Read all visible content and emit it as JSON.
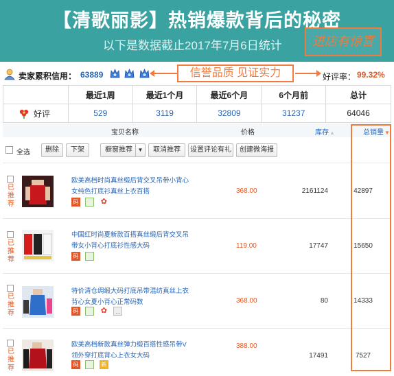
{
  "banner": {
    "title": "【清歌丽影】热销爆款背后的秘密",
    "subtitle": "以下是数据截止2017年7月6日统计",
    "stamp": "进店有惊喜"
  },
  "credit": {
    "label": "卖家累积信用：",
    "value": "63889",
    "callout": "信誉品质 见证实力",
    "rate_label": "好评率：",
    "rate_value": "99.32%"
  },
  "rating": {
    "headers": [
      "最近1周",
      "最近1个月",
      "最近6个月",
      "6个月前",
      "总计"
    ],
    "row_label": "好评",
    "values": [
      "529",
      "3119",
      "32809",
      "31237",
      "64046"
    ]
  },
  "product_header": {
    "name": "宝贝名称",
    "price": "价格",
    "stock": "库存",
    "sales": "总销量"
  },
  "toolbar": {
    "select_all": "全选",
    "delete": "删除",
    "offshelf": "下架",
    "showcase": "橱窗推荐",
    "cancel_recommend": "取消推荐",
    "set_review_gift": "设置评论有礼",
    "create_poster": "创建微海报"
  },
  "products": [
    {
      "status": "已推荐",
      "title": "欧美高档时尚真丝缎后背交叉吊带小背心女纯色打底衫真丝上衣百搭",
      "price": "368.00",
      "stock": "2161124",
      "sales": "42897"
    },
    {
      "status": "已推荐",
      "title": "中国红时尚夏新款百搭真丝缎后背交叉吊带女小背心打底衫性感大码",
      "price": "119.00",
      "stock": "17747",
      "sales": "15650"
    },
    {
      "status": "已推荐",
      "title": "特价清仓绸缎大码打底吊带混纺真丝上衣背心女夏小背心正常码数",
      "price": "368.00",
      "stock": "80",
      "sales": "14333"
    },
    {
      "status": "已推荐",
      "title": "欧美高档新款真丝弹力缎百搭性感吊带V领外穿打底背心上衣女大码",
      "price": "388.00",
      "stock": "17491",
      "sales": "7527"
    }
  ],
  "badges": {
    "code": "码",
    "new": "新"
  },
  "colors": {
    "banner_bg": "#3aa2a1",
    "accent_orange": "#f07b3c",
    "link_blue": "#2766b7",
    "price_orange": "#e8561e"
  }
}
